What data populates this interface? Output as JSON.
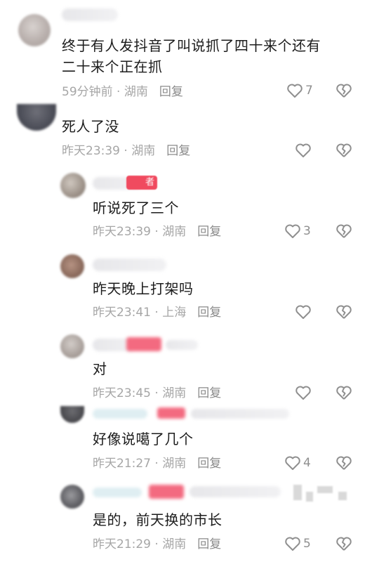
{
  "comments": [
    {
      "text": "终于有人发抖音了叫说抓了四十来个还有\n二十来个正在抓",
      "time": "59分钟前",
      "location": "湖南",
      "reply_label": "回复",
      "like_count": "7"
    },
    {
      "text": "死人了没",
      "time": "昨天23:39",
      "location": "湖南",
      "reply_label": "回复",
      "like_count": ""
    },
    {
      "text": "听说死了三个",
      "time": "昨天23:39",
      "location": "湖南",
      "reply_label": "回复",
      "like_count": "3",
      "badge": "者"
    },
    {
      "text": "昨天晚上打架吗",
      "time": "昨天23:41",
      "location": "上海",
      "reply_label": "回复",
      "like_count": ""
    },
    {
      "text": "对",
      "time": "昨天23:45",
      "location": "湖南",
      "reply_label": "回复",
      "like_count": ""
    },
    {
      "text": "好像说噶了几个",
      "time": "昨天21:27",
      "location": "湖南",
      "reply_label": "回复",
      "like_count": "4"
    },
    {
      "text": "是的，前天换的市长",
      "time": "昨天21:29",
      "location": "湖南",
      "reply_label": "回复",
      "like_count": "5"
    }
  ],
  "colors": {
    "text": "#1c1c1c",
    "meta": "#a6a6a6",
    "icon": "#8f8f8f",
    "badge": "#f04a5f"
  },
  "icons": [
    "heart-outline-icon",
    "broken-heart-icon"
  ]
}
